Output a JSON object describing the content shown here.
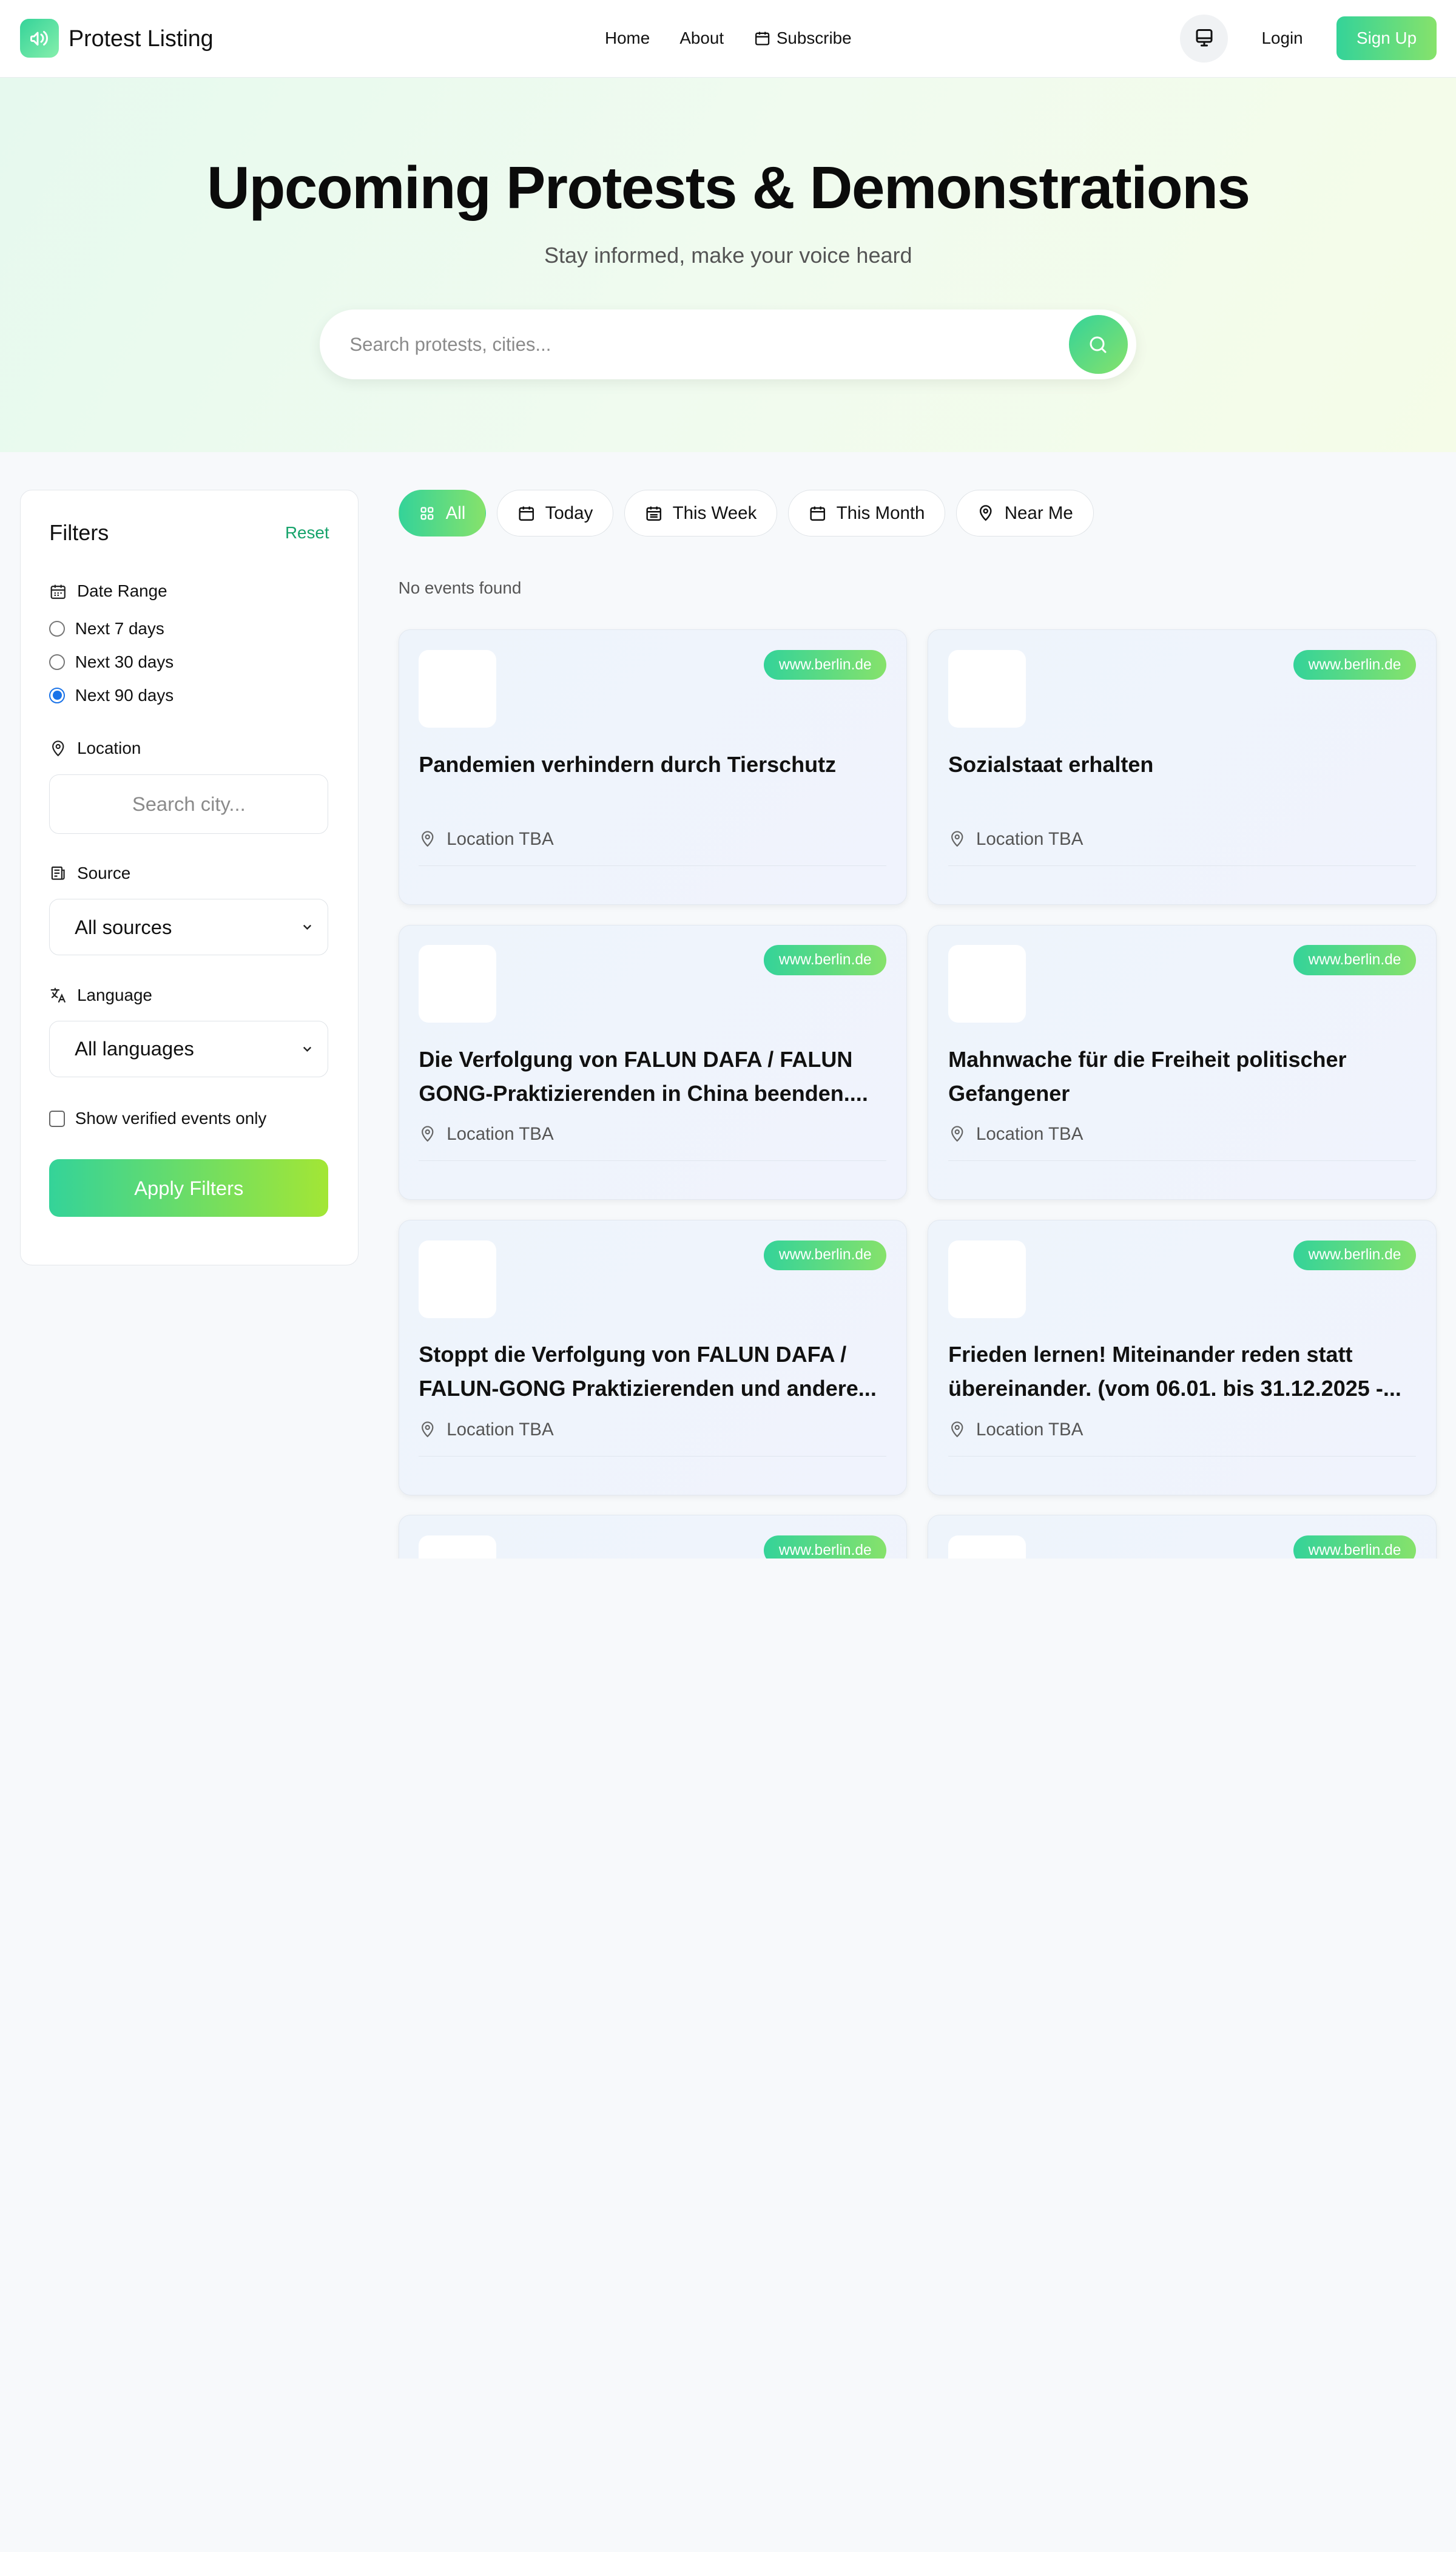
{
  "nav": {
    "brand": "Protest Listing",
    "links": {
      "home": "Home",
      "about": "About",
      "subscribe": "Subscribe"
    },
    "login": "Login",
    "signup": "Sign Up"
  },
  "hero": {
    "title": "Upcoming Protests & Demonstrations",
    "subtitle": "Stay informed, make your voice heard",
    "search_placeholder": "Search protests, cities..."
  },
  "filters": {
    "title": "Filters",
    "reset": "Reset",
    "date_range": {
      "label": "Date Range",
      "options": [
        "Next 7 days",
        "Next 30 days",
        "Next 90 days"
      ],
      "selected": "Next 90 days"
    },
    "location": {
      "label": "Location",
      "placeholder": "Search city..."
    },
    "source": {
      "label": "Source",
      "value": "All sources"
    },
    "language": {
      "label": "Language",
      "value": "All languages"
    },
    "verified_only": {
      "label": "Show verified events only",
      "checked": false
    },
    "apply": "Apply Filters"
  },
  "tabs": [
    "All",
    "Today",
    "This Week",
    "This Month",
    "Near Me"
  ],
  "active_tab": "All",
  "status": "No events found",
  "events": [
    {
      "source": "www.berlin.de",
      "title": "Pandemien verhindern durch Tierschutz",
      "location": "Location TBA"
    },
    {
      "source": "www.berlin.de",
      "title": "Sozialstaat erhalten",
      "location": "Location TBA"
    },
    {
      "source": "www.berlin.de",
      "title": "Die Verfolgung von FALUN DAFA / FALUN GONG-Praktizierenden in China beenden....",
      "location": "Location TBA"
    },
    {
      "source": "www.berlin.de",
      "title": "Mahnwache für die Freiheit politischer Gefangener",
      "location": "Location TBA"
    },
    {
      "source": "www.berlin.de",
      "title": "Stoppt die Verfolgung von FALUN DAFA / FALUN-GONG Praktizierenden und andere...",
      "location": "Location TBA"
    },
    {
      "source": "www.berlin.de",
      "title": "Frieden lernen! Miteinander reden statt übereinander. (vom 06.01. bis 31.12.2025 -...",
      "location": "Location TBA"
    },
    {
      "source": "www.berlin.de",
      "title": "",
      "location": ""
    },
    {
      "source": "www.berlin.de",
      "title": "",
      "location": ""
    }
  ],
  "colors": {
    "accent_start": "#34d399",
    "accent_end": "#86e26b",
    "link_green": "#16a36b",
    "radio_blue": "#1a73e8"
  }
}
